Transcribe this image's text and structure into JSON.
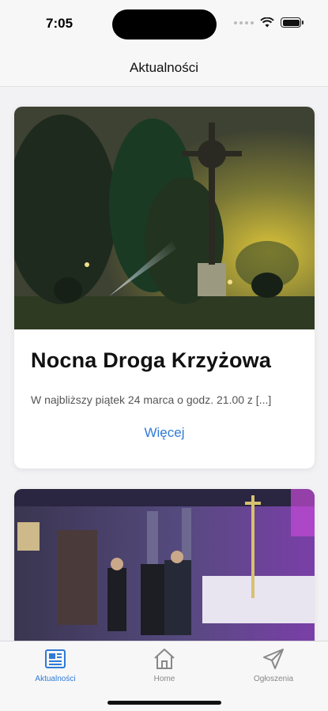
{
  "status_bar": {
    "time": "7:05"
  },
  "header": {
    "title": "Aktualności"
  },
  "posts": [
    {
      "title": "Nocna Droga Krzyżowa",
      "excerpt": "W najbliższy piątek 24 marca o godz. 21.00 z [...]",
      "more_label": "Więcej"
    }
  ],
  "tab_bar": {
    "items": [
      {
        "label": "Aktualności",
        "icon": "newspaper-icon",
        "active": true
      },
      {
        "label": "Home",
        "icon": "home-icon",
        "active": false
      },
      {
        "label": "Ogłoszenia",
        "icon": "paper-plane-icon",
        "active": false
      }
    ]
  },
  "colors": {
    "accent": "#2f7bd6",
    "inactive": "#888888"
  }
}
